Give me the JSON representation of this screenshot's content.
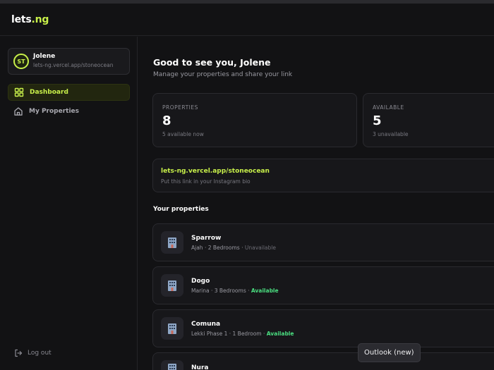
{
  "app": {
    "logo_main": "lets",
    "logo_dot": ".",
    "logo_tail": "ng",
    "accent_color": "#c8f04a"
  },
  "user": {
    "initials": "ST",
    "name": "Jolene",
    "url": "lets-ng.vercel.app/stoneocean"
  },
  "nav": {
    "items": [
      {
        "label": "Dashboard",
        "icon": "grid-icon",
        "active": true
      },
      {
        "label": "My Properties",
        "icon": "home-icon",
        "active": false
      }
    ],
    "logout_label": "Log out",
    "logout_icon": "logout-icon"
  },
  "greeting": {
    "title": "Good to see you, Jolene",
    "subtitle": "Manage your properties and share your link"
  },
  "stats": [
    {
      "label": "PROPERTIES",
      "value": "8",
      "note": "5 available now"
    },
    {
      "label": "AVAILABLE",
      "value": "5",
      "note": "3 unavailable"
    }
  ],
  "share_link": {
    "url": "lets-ng.vercel.app/stoneocean",
    "hint": "Put this link in your Instagram bio"
  },
  "properties_section": {
    "title": "Your properties",
    "items": [
      {
        "name": "Sparrow",
        "meta": "Ajah · 2 Bedrooms · ",
        "status": "Unavailable",
        "available": false,
        "icon": "building-icon"
      },
      {
        "name": "Dogo",
        "meta": "Marina · 3 Bedrooms · ",
        "status": "Available",
        "available": true,
        "icon": "building-icon"
      },
      {
        "name": "Comuna",
        "meta": "Lekki Phase 1 · 1 Bedroom · ",
        "status": "Available",
        "available": true,
        "icon": "building-icon"
      },
      {
        "name": "Nura",
        "meta": "",
        "status": "",
        "available": true,
        "icon": "building-icon"
      }
    ]
  },
  "tooltip": {
    "text": "Outlook (new)"
  }
}
